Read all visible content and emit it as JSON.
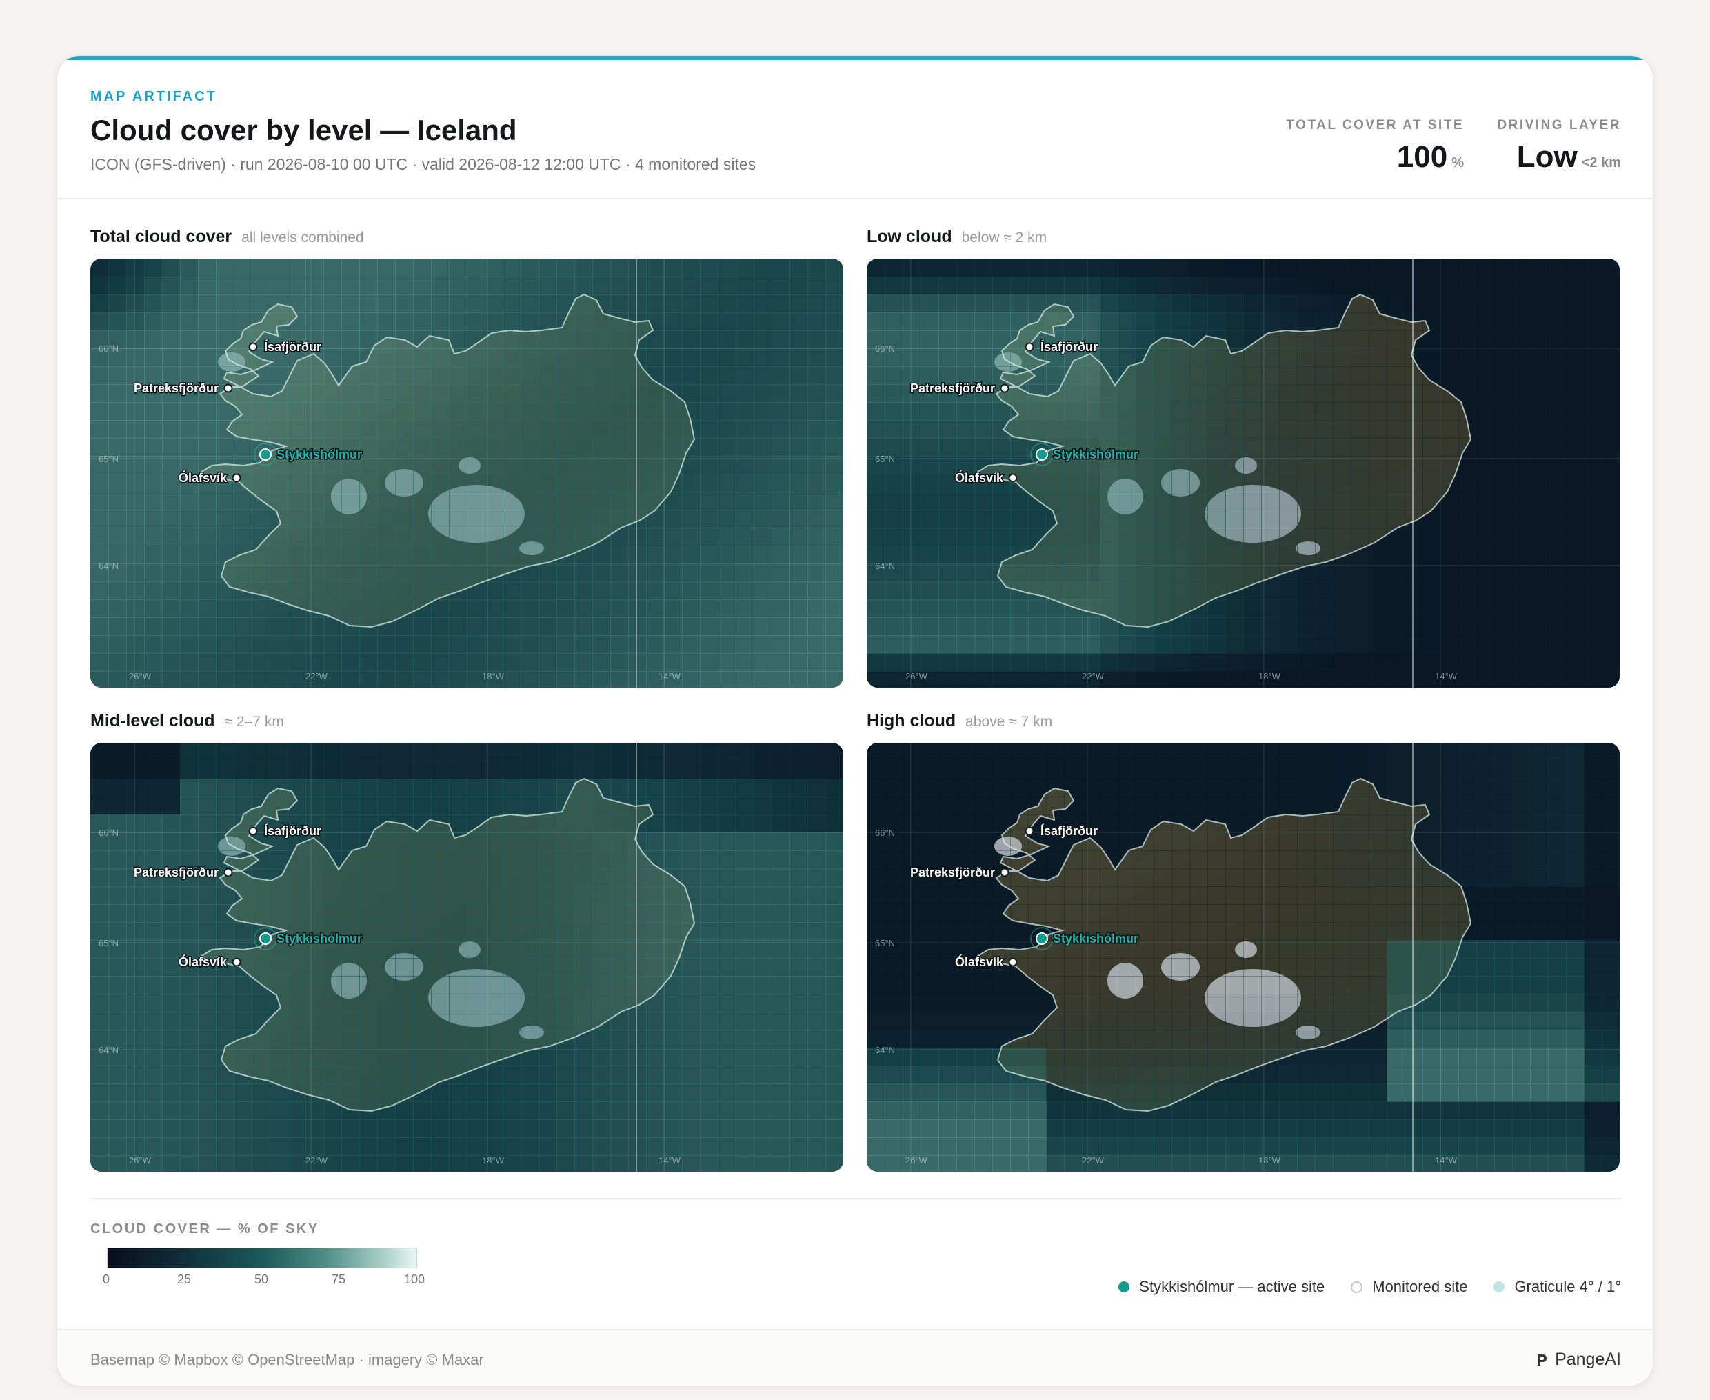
{
  "header": {
    "eyebrow": "MAP ARTIFACT",
    "title": "Cloud cover by level — Iceland",
    "subtitle": "ICON (GFS-driven) · run 2026-08-10 00 UTC · valid 2026-08-12 12:00 UTC · 4 monitored sites",
    "stat_total": {
      "label": "TOTAL COVER AT SITE",
      "value": "100",
      "unit": "%"
    },
    "stat_layer": {
      "label": "DRIVING LAYER",
      "value": "Low",
      "unit": "<2 km"
    }
  },
  "panels": [
    {
      "title": "Total cloud cover",
      "subtitle": "all levels combined",
      "cover": "total"
    },
    {
      "title": "Low cloud",
      "subtitle": "below ≈ 2 km",
      "cover": "low"
    },
    {
      "title": "Mid-level cloud",
      "subtitle": "≈ 2–7 km",
      "cover": "mid"
    },
    {
      "title": "High cloud",
      "subtitle": "above ≈ 7 km",
      "cover": "high"
    }
  ],
  "map": {
    "lat_labels": [
      "66°N",
      "65°N",
      "64°N"
    ],
    "lon_labels": [
      "26°W",
      "22°W",
      "18°W",
      "14°W"
    ],
    "sites": [
      {
        "name": "Ísafjörður",
        "active": false
      },
      {
        "name": "Patreksfjörður",
        "active": false
      },
      {
        "name": "Stykkishólmur",
        "active": true
      },
      {
        "name": "Ólafsvík",
        "active": false
      }
    ]
  },
  "legend": {
    "title": "CLOUD COVER — % OF SKY",
    "ticks": [
      "0",
      "25",
      "50",
      "75",
      "100"
    ],
    "keys": [
      {
        "label": "Stykkishólmur — active site",
        "color": "#159a8f"
      },
      {
        "label": "Monitored site",
        "color": "#ffffff"
      },
      {
        "label": "Graticule 4° / 1°",
        "color": "#bfe6e3"
      }
    ]
  },
  "footer": {
    "credit": "Basemap © Mapbox © OpenStreetMap · imagery © Maxar",
    "brand": "PangeAI"
  },
  "colors": {
    "accent": "#1fa6c9",
    "active_site": "#159a8f",
    "cloud_low": "#0a1320",
    "cloud_high": "#dff2ee"
  }
}
